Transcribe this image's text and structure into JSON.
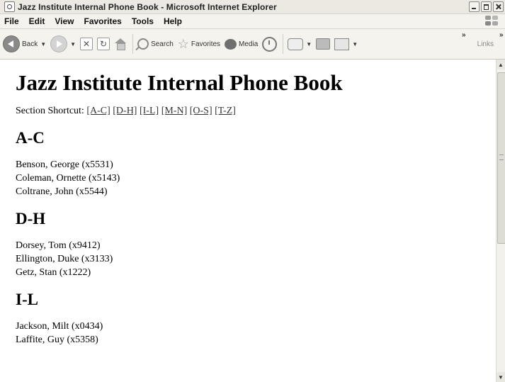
{
  "window": {
    "title": "Jazz Institute Internal Phone Book - Microsoft Internet Explorer"
  },
  "menubar": {
    "items": [
      "File",
      "Edit",
      "View",
      "Favorites",
      "Tools",
      "Help"
    ]
  },
  "toolbar": {
    "back_label": "Back",
    "search_label": "Search",
    "favorites_label": "Favorites",
    "media_label": "Media",
    "chevron": "»",
    "links_label": "Links"
  },
  "page": {
    "title": "Jazz Institute Internal Phone Book",
    "shortcut_label": "Section Shortcut:",
    "shortcuts": [
      "[A-C]",
      "[D-H]",
      "[I-L]",
      "[M-N]",
      "[O-S]",
      "[T-Z]"
    ],
    "sections": [
      {
        "title": "A-C",
        "entries": [
          "Benson, George (x5531)",
          "Coleman, Ornette (x5143)",
          "Coltrane, John (x5544)"
        ]
      },
      {
        "title": "D-H",
        "entries": [
          "Dorsey, Tom (x9412)",
          "Ellington, Duke (x3133)",
          "Getz, Stan (x1222)"
        ]
      },
      {
        "title": "I-L",
        "entries": [
          "Jackson, Milt (x0434)",
          "Laffite, Guy (x5358)"
        ]
      }
    ]
  }
}
